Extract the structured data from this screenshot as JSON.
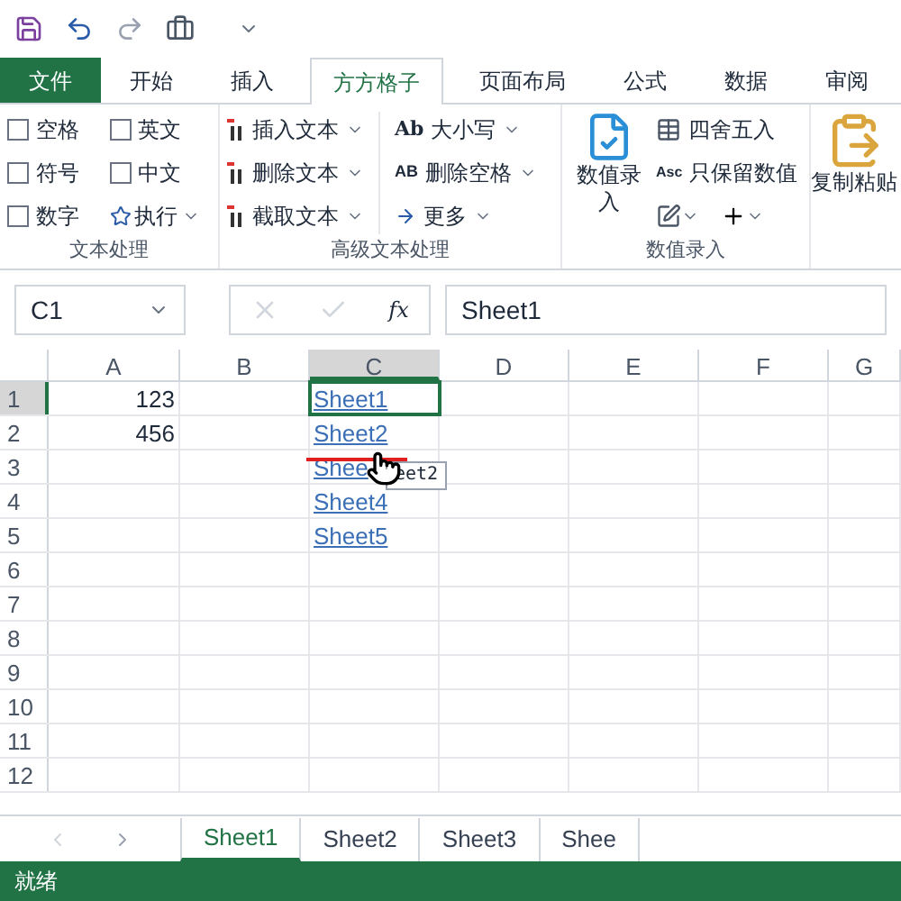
{
  "ribbon_tabs": [
    {
      "label": "文件",
      "kind": "file",
      "selected": false
    },
    {
      "label": "开始",
      "kind": "tab",
      "selected": false
    },
    {
      "label": "插入",
      "kind": "tab",
      "selected": false
    },
    {
      "label": "方方格子",
      "kind": "tab",
      "selected": true
    },
    {
      "label": "页面布局",
      "kind": "tab",
      "selected": false
    },
    {
      "label": "公式",
      "kind": "tab",
      "selected": false
    },
    {
      "label": "数据",
      "kind": "tab",
      "selected": false
    },
    {
      "label": "审阅",
      "kind": "tab",
      "selected": false
    }
  ],
  "text_group": {
    "label": "文本处理",
    "checkboxes": [
      {
        "label": "空格",
        "checked": false
      },
      {
        "label": "英文",
        "checked": false
      },
      {
        "label": "符号",
        "checked": false
      },
      {
        "label": "中文",
        "checked": false
      },
      {
        "label": "数字",
        "checked": false
      }
    ],
    "run_button": "执行"
  },
  "advanced_group": {
    "label": "高级文本处理",
    "left": [
      "插入文本",
      "删除文本",
      "截取文本"
    ],
    "case_icon": "Ab",
    "case_label": "大小写",
    "space_icon": "AB",
    "space_label": "删除空格",
    "more_label": "更多"
  },
  "number_group": {
    "label": "数值录入",
    "big_button": "数值录入",
    "round_label": "四舍五入",
    "keep_icon": "Asc",
    "keep_label": "只保留数值"
  },
  "paste_button": "复制粘贴",
  "formula_bar": {
    "name_box": "C1",
    "fx_label": "fx",
    "value": "Sheet1"
  },
  "columns": [
    {
      "label": "A",
      "selected": false
    },
    {
      "label": "B",
      "selected": false
    },
    {
      "label": "C",
      "selected": true
    },
    {
      "label": "D",
      "selected": false
    },
    {
      "label": "E",
      "selected": false
    },
    {
      "label": "F",
      "selected": false
    },
    {
      "label": "G",
      "selected": false
    }
  ],
  "rows": [
    {
      "number": "1",
      "selected": true,
      "column_a": "123",
      "column_c": "Sheet1"
    },
    {
      "number": "2",
      "selected": false,
      "column_a": "456",
      "column_c": "Sheet2"
    },
    {
      "number": "3",
      "selected": false,
      "column_c": "Shee"
    },
    {
      "number": "4",
      "selected": false,
      "column_c": "Sheet4"
    },
    {
      "number": "5",
      "selected": false,
      "column_c": "Sheet5"
    },
    {
      "number": "6",
      "selected": false
    },
    {
      "number": "7",
      "selected": false
    },
    {
      "number": "8",
      "selected": false
    },
    {
      "number": "9",
      "selected": false
    },
    {
      "number": "10",
      "selected": false
    },
    {
      "number": "11",
      "selected": false
    },
    {
      "number": "12",
      "selected": false
    }
  ],
  "tooltip": "eet2",
  "sheet_tabs": [
    {
      "label": "Sheet1",
      "selected": true
    },
    {
      "label": "Sheet2",
      "selected": false
    },
    {
      "label": "Sheet3",
      "selected": false
    },
    {
      "label": "Shee",
      "selected": false
    }
  ],
  "status_bar": "就绪"
}
